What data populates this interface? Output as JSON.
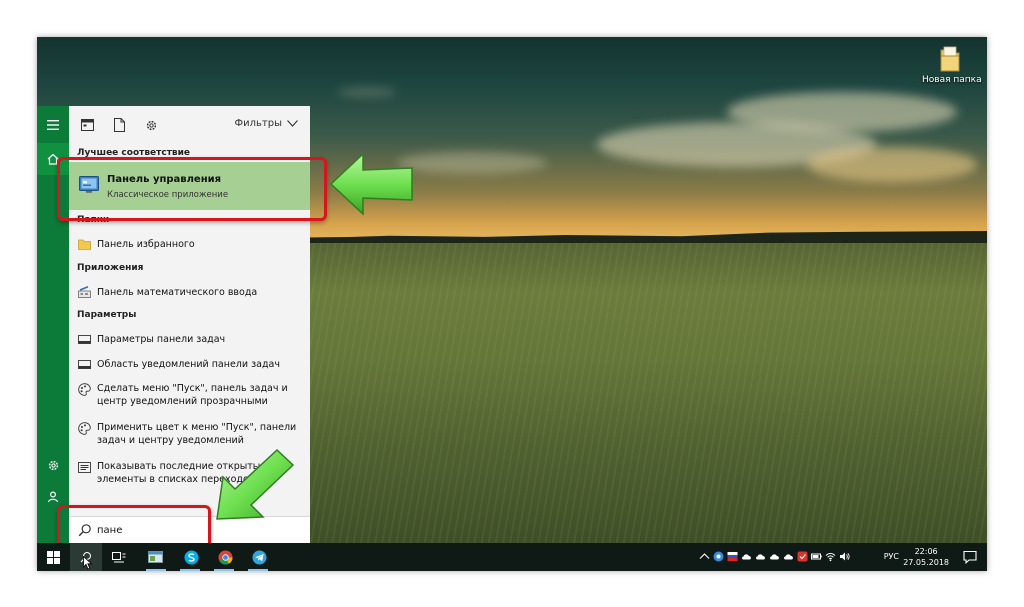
{
  "desktop": {
    "icon_label": "Новая папка"
  },
  "start_panel": {
    "filters_label": "Фильтры",
    "best_match": {
      "header": "Лучшее соответствие",
      "title": "Панель управления",
      "subtitle": "Классическое приложение"
    },
    "sections": [
      {
        "header": "Папки",
        "items": [
          {
            "text": "Панель избранного",
            "icon": "folder-icon"
          }
        ]
      },
      {
        "header": "Приложения",
        "items": [
          {
            "text": "Панель математического ввода",
            "icon": "math-input-icon"
          }
        ]
      },
      {
        "header": "Параметры",
        "items": [
          {
            "text": "Параметры панели задач",
            "icon": "taskbar-settings-icon"
          },
          {
            "text": "Область уведомлений панели задач",
            "icon": "taskbar-settings-icon"
          },
          {
            "text": "Сделать меню \"Пуск\", панель задач и центр уведомлений прозрачными",
            "icon": "palette-icon"
          },
          {
            "text": "Применить цвет к меню \"Пуск\", панели задач и центру уведомлений",
            "icon": "palette-icon"
          },
          {
            "text": "Показывать последние открытые элементы в списках переходов",
            "icon": "recent-items-icon"
          }
        ]
      }
    ],
    "search": {
      "value": "пане"
    }
  },
  "taskbar": {
    "language": "РУС",
    "time": "22:06",
    "date": "27.05.2018"
  },
  "colors": {
    "accent": "#0c7a38",
    "highlight": "#a6cf93",
    "annotation_red": "#d8141c",
    "arrow_green": "#6fe050"
  }
}
